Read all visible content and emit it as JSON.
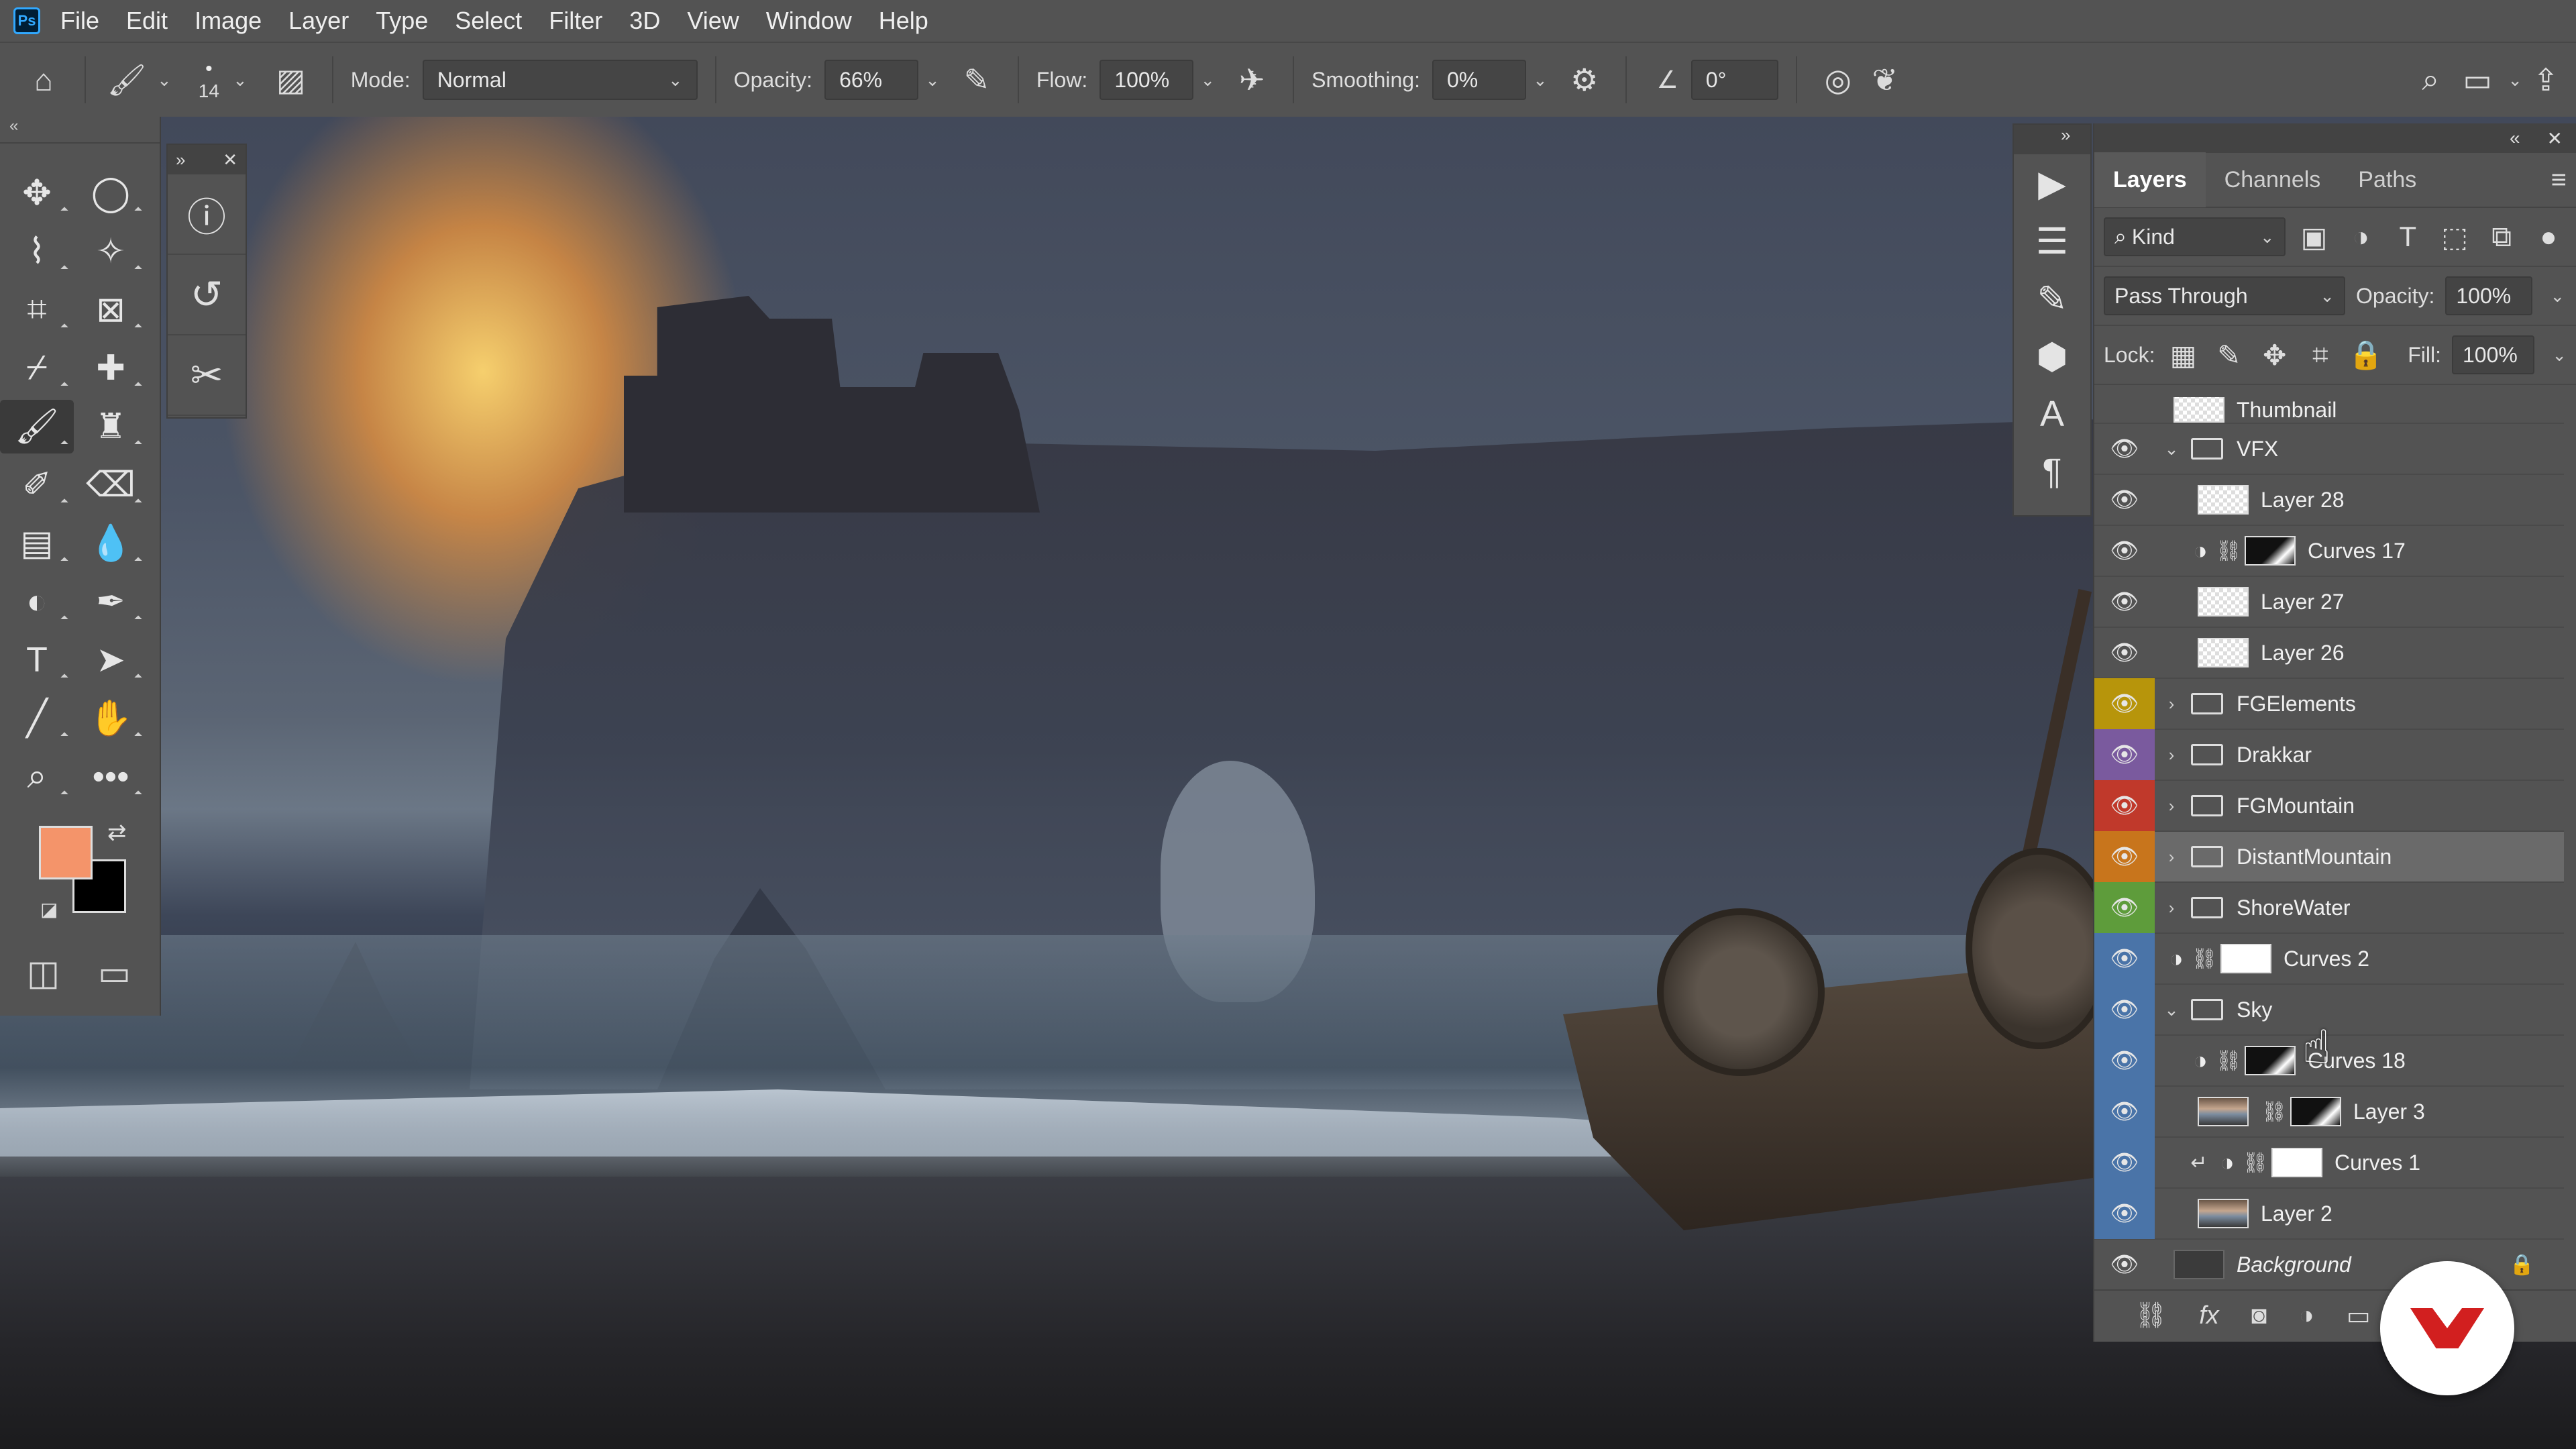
{
  "menubar": {
    "logo": "Ps",
    "items": [
      "File",
      "Edit",
      "Image",
      "Layer",
      "Type",
      "Select",
      "Filter",
      "3D",
      "View",
      "Window",
      "Help"
    ]
  },
  "options": {
    "brush_size": "14",
    "mode_label": "Mode:",
    "mode_value": "Normal",
    "opacity_label": "Opacity:",
    "opacity_value": "66%",
    "flow_label": "Flow:",
    "flow_value": "100%",
    "smoothing_label": "Smoothing:",
    "smoothing_value": "0%",
    "angle_value": "0°"
  },
  "layers_panel": {
    "tabs": [
      "Layers",
      "Channels",
      "Paths"
    ],
    "active_tab": "Layers",
    "filter_kind": "Kind",
    "blend_mode": "Pass Through",
    "opacity_label": "Opacity:",
    "opacity_value": "100%",
    "lock_label": "Lock:",
    "fill_label": "Fill:",
    "fill_value": "100%",
    "layers": [
      {
        "name": "Thumbnail",
        "type": "layer",
        "partial": true
      },
      {
        "name": "VFX",
        "type": "group",
        "expanded": true,
        "color": "none"
      },
      {
        "name": "Layer 28",
        "type": "layer",
        "indent": 1,
        "thumb": "checker"
      },
      {
        "name": "Curves 17",
        "type": "adjustment",
        "indent": 1,
        "mask": true
      },
      {
        "name": "Layer 27",
        "type": "layer",
        "indent": 1,
        "thumb": "checker"
      },
      {
        "name": "Layer 26",
        "type": "layer",
        "indent": 1,
        "thumb": "checker"
      },
      {
        "name": "FGElements",
        "type": "group",
        "expanded": false,
        "color": "#b7950b"
      },
      {
        "name": "Drakkar",
        "type": "group",
        "expanded": false,
        "color": "#7a5a9e"
      },
      {
        "name": "FGMountain",
        "type": "group",
        "expanded": false,
        "color": "#c0392b"
      },
      {
        "name": "DistantMountain",
        "type": "group",
        "expanded": false,
        "color": "#c8751c",
        "selected": true
      },
      {
        "name": "ShoreWater",
        "type": "group",
        "expanded": false,
        "color": "#5e9c3b"
      },
      {
        "name": "Curves 2",
        "type": "adjustment",
        "mask": true,
        "color": "#4a74a8"
      },
      {
        "name": "Sky",
        "type": "group",
        "expanded": true,
        "color": "#4a74a8"
      },
      {
        "name": "Curves 18",
        "type": "adjustment",
        "indent": 1,
        "mask": true,
        "color": "#4a74a8"
      },
      {
        "name": "Layer 3",
        "type": "layer",
        "indent": 1,
        "thumb": "photo",
        "mask": true,
        "color": "#4a74a8"
      },
      {
        "name": "Curves 1",
        "type": "adjustment",
        "indent": 1,
        "clipped": true,
        "mask": true,
        "color": "#4a74a8"
      },
      {
        "name": "Layer 2",
        "type": "layer",
        "indent": 1,
        "thumb": "photo",
        "color": "#4a74a8"
      },
      {
        "name": "Background",
        "type": "background",
        "locked": true
      }
    ]
  },
  "colors": {
    "foreground": "#f4946a",
    "background": "#000000"
  }
}
